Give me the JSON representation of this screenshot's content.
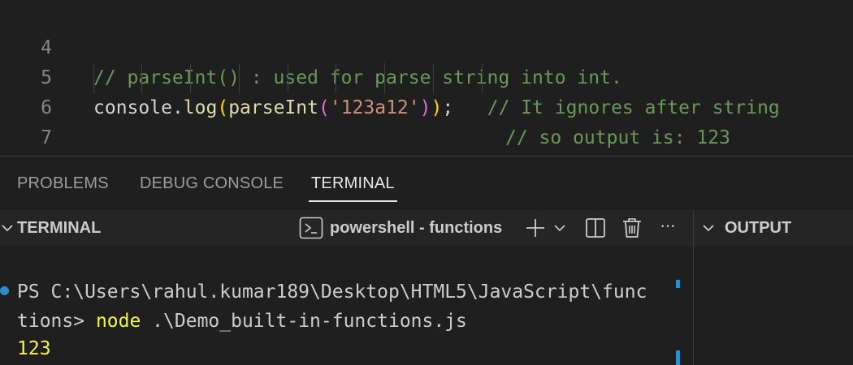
{
  "editor": {
    "lines": [
      {
        "number": "4",
        "comment": "// parseInt() : used for parse string into int."
      },
      {
        "number": "5",
        "ident": "console",
        "dot": ".",
        "method": "log",
        "open1": "(",
        "func": "parseInt",
        "open2": "(",
        "string": "'123a12'",
        "close2": ")",
        "close1": ")",
        "semi": ";",
        "comment": "// It ignores after string"
      },
      {
        "number": "6",
        "comment": "// so output is: 123"
      },
      {
        "number": "7"
      }
    ]
  },
  "panel": {
    "tabs": [
      {
        "label": "PROBLEMS"
      },
      {
        "label": "DEBUG CONSOLE"
      },
      {
        "label": "TERMINAL",
        "active": true
      }
    ]
  },
  "terminal": {
    "title": "TERMINAL",
    "profile_label": "powershell - functions",
    "icons": [
      "terminal-icon",
      "plus-icon",
      "chevron-down-icon",
      "split-icon",
      "trash-icon",
      "more-icon"
    ],
    "more_glyph": "···",
    "lines": {
      "prompt1": "PS C:\\Users\\rahul.kumar189\\Desktop\\HTML5\\JavaScript\\func",
      "prompt2": "tions> ",
      "cmd": "node",
      "args": " .\\Demo_built-in-functions.js",
      "output": "123"
    }
  },
  "output": {
    "title": "OUTPUT"
  },
  "colors": {
    "comment": "#6a9955",
    "string": "#ce9178",
    "function": "#dcdcaa",
    "accent": "#2a8fd1",
    "terminal_yellow": "#f5f543"
  }
}
